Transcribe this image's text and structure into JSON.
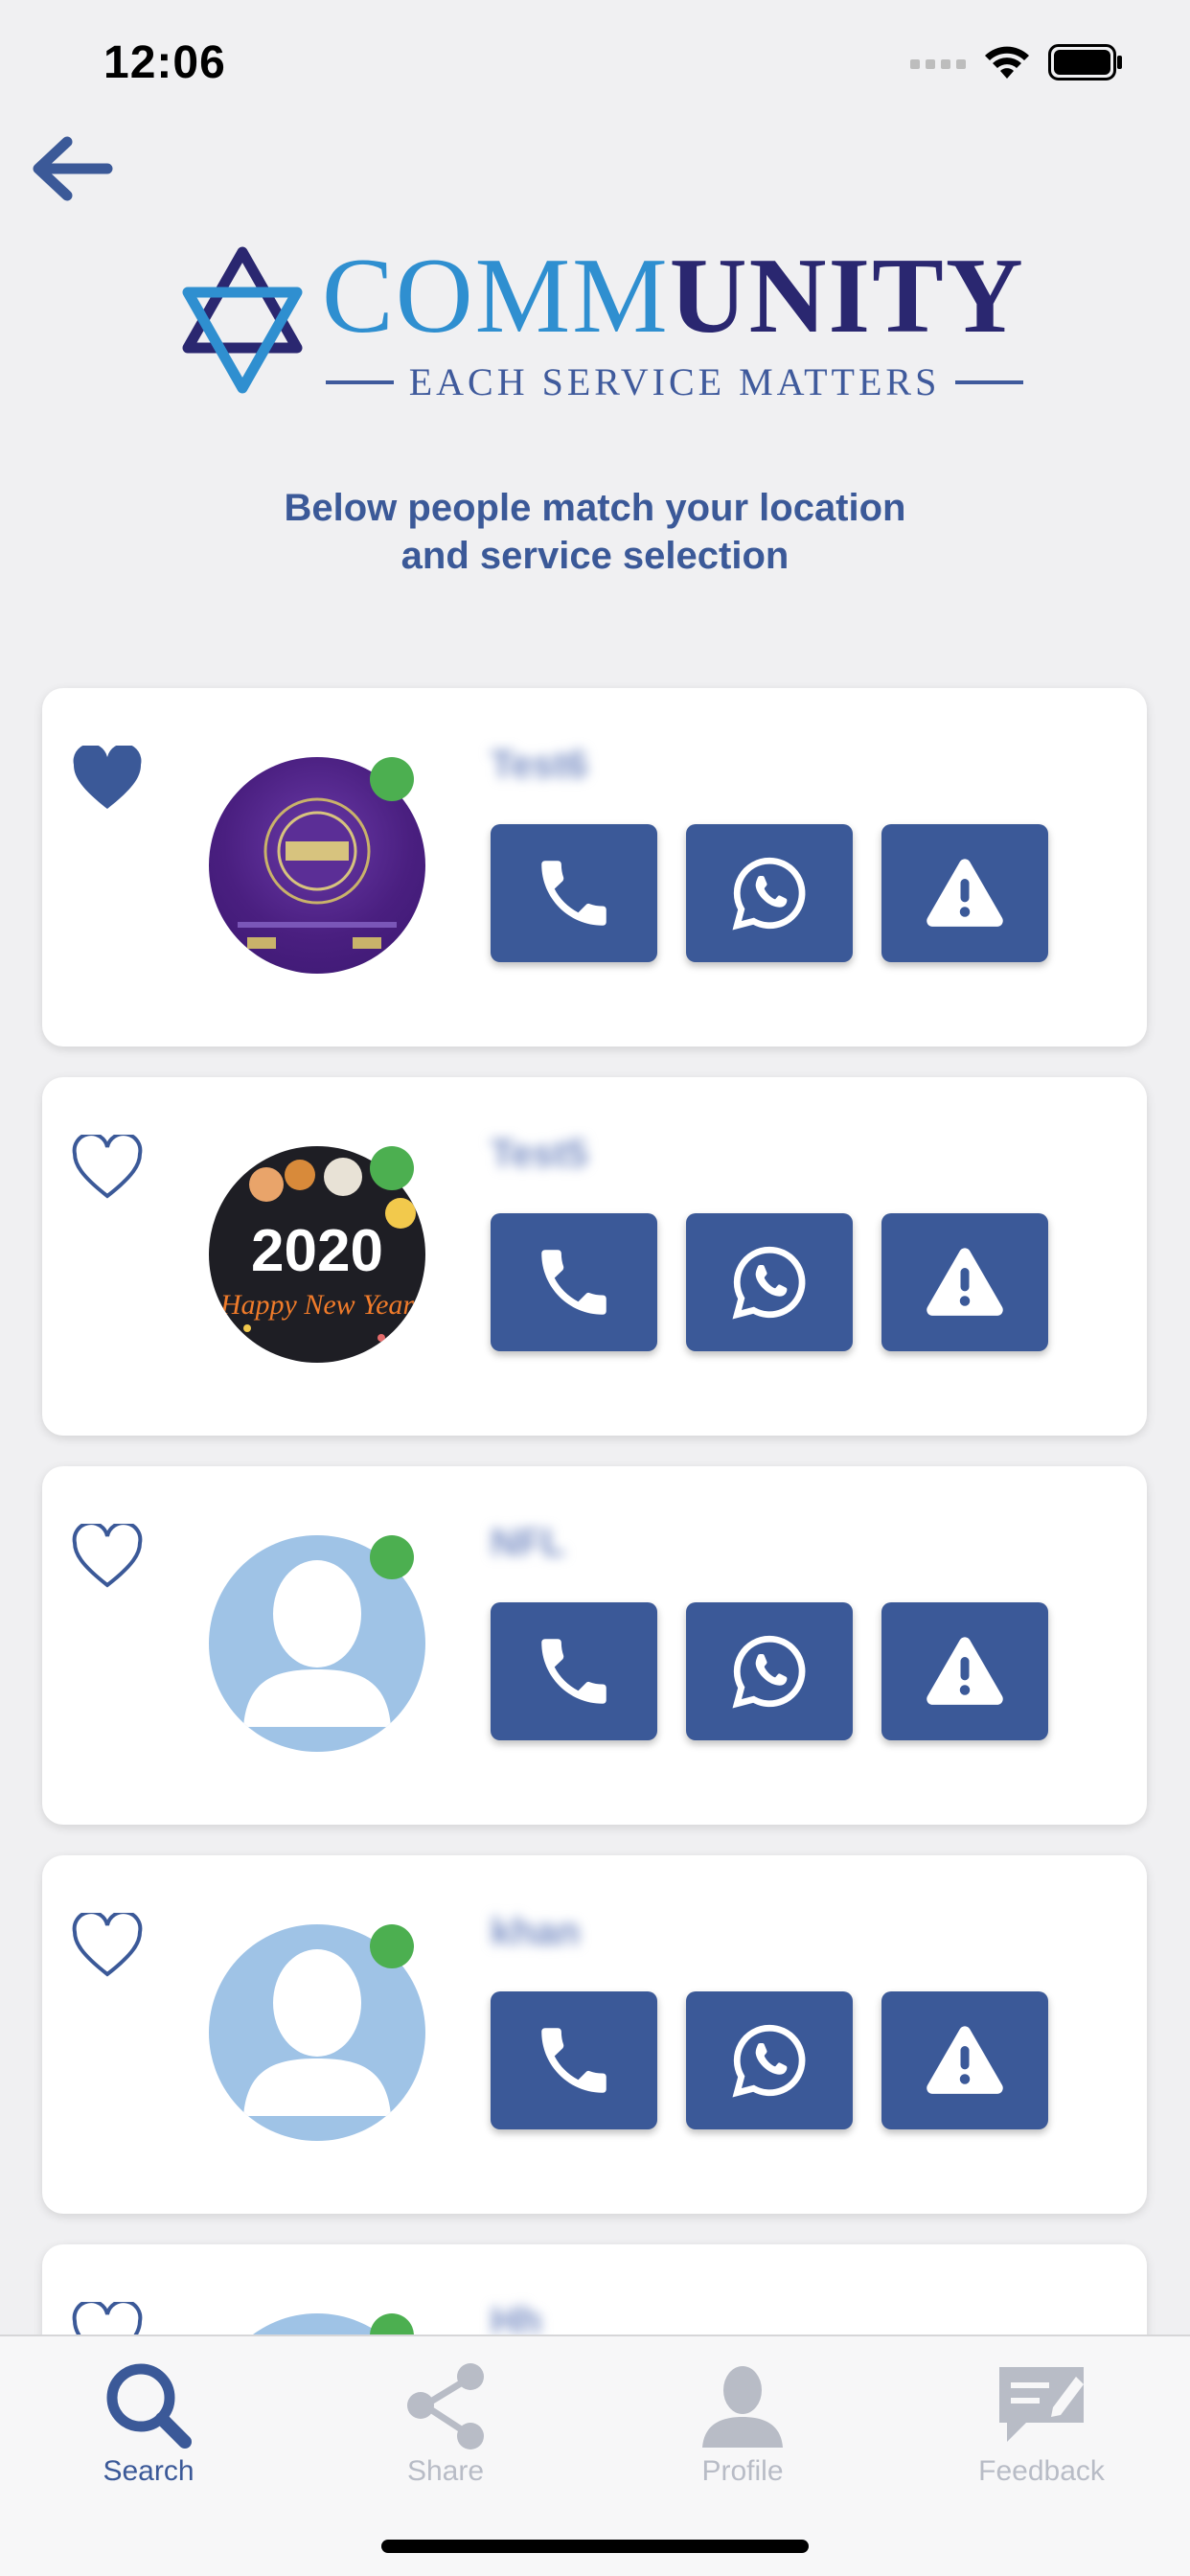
{
  "status_bar": {
    "time": "12:06"
  },
  "header": {
    "logo_main_light": "COMM",
    "logo_main_dark": "UNITY",
    "logo_tagline": "EACH SERVICE MATTERS",
    "subtitle_line1": "Below people match your location",
    "subtitle_line2": "and service selection"
  },
  "colors": {
    "primary": "#3b5998",
    "online": "#4caf50",
    "inactive": "#b8bcc6"
  },
  "results": [
    {
      "name": "Test6",
      "favorite": true,
      "avatar": "crorepati-image"
    },
    {
      "name": "Test5",
      "favorite": false,
      "avatar": "new-year-2020-image"
    },
    {
      "name": "NFL",
      "favorite": false,
      "avatar": "default-user-icon"
    },
    {
      "name": "khan",
      "favorite": false,
      "avatar": "default-user-icon"
    },
    {
      "name": "Hh",
      "favorite": false,
      "avatar": "default-user-icon"
    }
  ],
  "tabs": [
    {
      "label": "Search",
      "icon": "search-icon",
      "active": true
    },
    {
      "label": "Share",
      "icon": "share-icon",
      "active": false
    },
    {
      "label": "Profile",
      "icon": "profile-icon",
      "active": false
    },
    {
      "label": "Feedback",
      "icon": "feedback-icon",
      "active": false
    }
  ]
}
